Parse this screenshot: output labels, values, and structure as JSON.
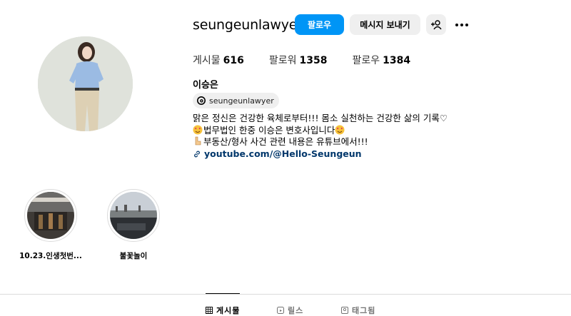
{
  "profile": {
    "username": "seungeunlawyer",
    "full_name": "이승은",
    "threads_handle": "seungeunlawyer"
  },
  "actions": {
    "follow": "팔로우",
    "message": "메시지 보내기",
    "add_user_icon": "add-user-icon",
    "more_icon": "more-icon"
  },
  "stats": {
    "posts_label": "게시물",
    "posts_value": "616",
    "followers_label": "팔로워",
    "followers_value": "1358",
    "following_label": "팔로우",
    "following_value": "1384"
  },
  "bio": {
    "line1": "맑은 정신은 건강한 육체로부터!!! 몸소 실천하는 건강한 삶의 기록♡",
    "line2": "법무법인 한중 이승은 변호사입니다",
    "line3": "부동산/형사 사건 관련 내용은 유튜브에서!!!",
    "link": "youtube.com/@Hello-Seungeun"
  },
  "highlights": [
    {
      "label": "10.23.인생첫번..."
    },
    {
      "label": "불꽃놀이"
    }
  ],
  "tabs": [
    {
      "label": "게시물",
      "active": true
    },
    {
      "label": "릴스",
      "active": false
    },
    {
      "label": "태그됨",
      "active": false
    }
  ],
  "colors": {
    "accent": "#0095f6",
    "link": "#00376b",
    "button_bg": "#efefef"
  }
}
